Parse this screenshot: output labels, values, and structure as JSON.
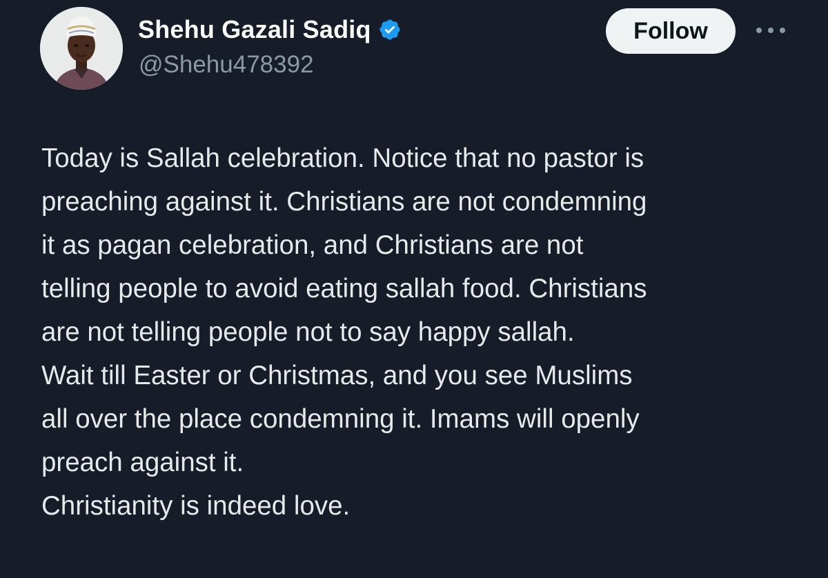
{
  "author": {
    "display_name": "Shehu Gazali Sadiq",
    "handle": "@Shehu478392",
    "verified": true,
    "avatar_icon": "profile-photo",
    "verified_color": "#1d9bf0"
  },
  "actions": {
    "follow_label": "Follow",
    "more_icon": "more-horizontal-icon"
  },
  "tweet": {
    "lines": [
      "Today is Sallah celebration. Notice that no pastor is",
      "preaching against it. Christians are not condemning",
      "it as pagan celebration, and Christians are not",
      "telling people to avoid eating sallah food. Christians",
      "are not telling people not to say happy sallah.",
      "Wait till Easter or Christmas, and you see Muslims",
      "all over the place condemning it. Imams will openly",
      "preach against it.",
      "Christianity is indeed love."
    ]
  },
  "theme": {
    "background": "#161d28",
    "text": "#e7e9ea",
    "secondary_text": "#8b98a5",
    "button_bg": "#eff3f4"
  }
}
